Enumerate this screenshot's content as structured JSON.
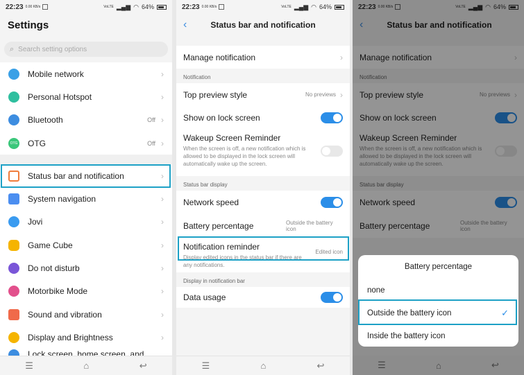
{
  "status": {
    "time": "22:23",
    "net_small": "0.00 KB/s",
    "battery": "64%",
    "volte": "VoLTE"
  },
  "settings": {
    "title": "Settings",
    "search_placeholder": "Search setting options",
    "items": [
      {
        "label": "Mobile network",
        "value": "",
        "color": "#3aa0e6"
      },
      {
        "label": "Personal Hotspot",
        "value": "",
        "color": "#2fbf9f"
      },
      {
        "label": "Bluetooth",
        "value": "Off",
        "color": "#3d8de0"
      },
      {
        "label": "OTG",
        "value": "Off",
        "color": "#3ac77a"
      },
      {
        "label": "Status bar and notification",
        "value": "",
        "color": "#f07d3c"
      },
      {
        "label": "System navigation",
        "value": "",
        "color": "#4b8ef0"
      },
      {
        "label": "Jovi",
        "value": "",
        "color": "#3a9bf0"
      },
      {
        "label": "Game Cube",
        "value": "",
        "color": "#f5b400"
      },
      {
        "label": "Do not disturb",
        "value": "",
        "color": "#7a56d8"
      },
      {
        "label": "Motorbike Mode",
        "value": "",
        "color": "#e2508c"
      },
      {
        "label": "Sound and vibration",
        "value": "",
        "color": "#f06a4a"
      },
      {
        "label": "Display and Brightness",
        "value": "",
        "color": "#f5b400"
      },
      {
        "label": "Lock screen, home screen, and",
        "value": "",
        "color": "#3d8de0"
      }
    ]
  },
  "detail": {
    "title": "Status bar and notification",
    "manage": "Manage notification",
    "sec_notification": "Notification",
    "top_preview": "Top preview style",
    "top_preview_value": "No previews",
    "show_lock": "Show on lock screen",
    "wakeup_title": "Wakeup Screen Reminder",
    "wakeup_desc": "When the screen is off, a new notification which is allowed to be displayed in the lock screen will automatically wake up the screen.",
    "sec_status": "Status bar display",
    "network_speed": "Network speed",
    "battery_pct": "Battery percentage",
    "battery_pct_value": "Outside the battery icon",
    "notif_reminder": "Notification reminder",
    "notif_reminder_desc": "Display edited icons in the status bar if there are any notifications.",
    "notif_reminder_value": "Edited icon",
    "sec_display": "Display in notification bar",
    "data_usage": "Data usage"
  },
  "dialog": {
    "title": "Battery percentage",
    "options": [
      "none",
      "Outside the battery icon",
      "Inside the battery icon"
    ],
    "selected": 1
  },
  "nav": {
    "menu": "☰",
    "home": "⌂",
    "back": "↩"
  },
  "accent": "#1da1c6"
}
